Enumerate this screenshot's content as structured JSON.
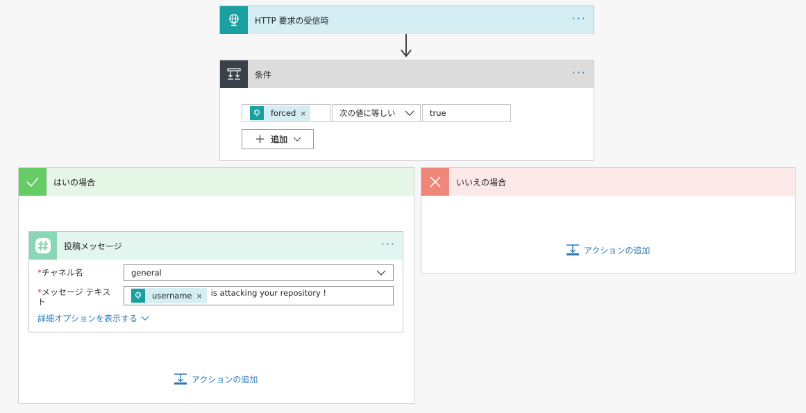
{
  "trigger": {
    "title": "HTTP 要求の受信時",
    "icon": "http-globe-icon",
    "color": "#1aa0a0"
  },
  "condition": {
    "title": "条件",
    "icon": "condition-icon",
    "left_token": "forced",
    "token_remove": "×",
    "operator": "次の値に等しい",
    "right_value": "true",
    "add_label": "追加"
  },
  "yes_branch": {
    "title": "はいの場合",
    "icon": "check-icon",
    "color": "#66cc66",
    "add_action_label": "アクションの追加"
  },
  "no_branch": {
    "title": "いいえの場合",
    "icon": "x-icon",
    "color": "#f0857a",
    "add_action_label": "アクションの追加"
  },
  "slack_action": {
    "title": "投稿メッセージ",
    "icon": "slack-hash-icon",
    "channel_label": "チャネル名",
    "channel_value": "general",
    "message_label": "メッセージ テキスト",
    "message_token": "username",
    "token_remove": "×",
    "message_rest": "is attacking your repository !",
    "required_mark": "*",
    "advanced_link": "詳細オプションを表示する"
  },
  "more_dots": "···"
}
